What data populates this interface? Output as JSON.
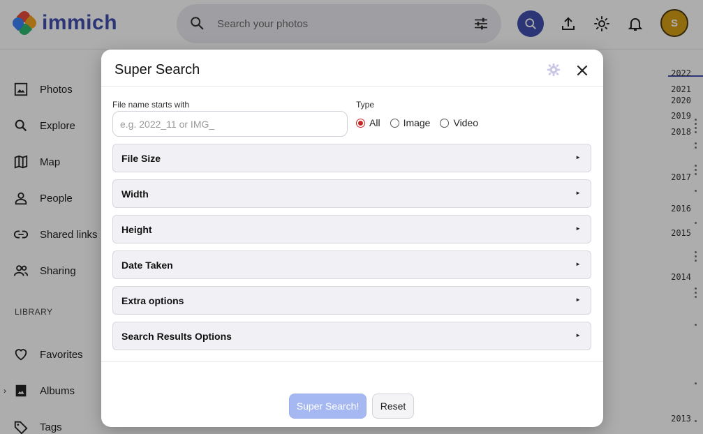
{
  "app": {
    "name": "immich"
  },
  "header": {
    "search_placeholder": "Search your photos",
    "avatar_initial": "S"
  },
  "sidebar": {
    "items": [
      {
        "label": "Photos",
        "icon": "photos-icon"
      },
      {
        "label": "Explore",
        "icon": "search-icon"
      },
      {
        "label": "Map",
        "icon": "map-icon"
      },
      {
        "label": "People",
        "icon": "person-icon"
      },
      {
        "label": "Shared links",
        "icon": "link-icon"
      },
      {
        "label": "Sharing",
        "icon": "people-icon"
      }
    ],
    "library_heading": "LIBRARY",
    "library_items": [
      {
        "label": "Favorites",
        "icon": "heart-icon"
      },
      {
        "label": "Albums",
        "icon": "album-icon"
      },
      {
        "label": "Tags",
        "icon": "tag-icon"
      }
    ]
  },
  "timeline": {
    "years": [
      "2022",
      "2021",
      "2020",
      "2019",
      "2018",
      "2017",
      "2016",
      "2015",
      "2014",
      "2013"
    ]
  },
  "modal": {
    "title": "Super Search",
    "file_name_label": "File name starts with",
    "file_name_placeholder": "e.g. 2022_11 or IMG_",
    "file_name_value": "",
    "type_label": "Type",
    "type_options": [
      "All",
      "Image",
      "Video"
    ],
    "type_selected": "All",
    "sections": [
      "File Size",
      "Width",
      "Height",
      "Date Taken",
      "Extra options",
      "Search Results Options"
    ],
    "submit_label": "Super Search!",
    "reset_label": "Reset"
  },
  "colors": {
    "brand": "#4250af",
    "radio_selected": "#c62828",
    "primary_button": "#a6b8f2",
    "avatar": "#d4a017"
  }
}
